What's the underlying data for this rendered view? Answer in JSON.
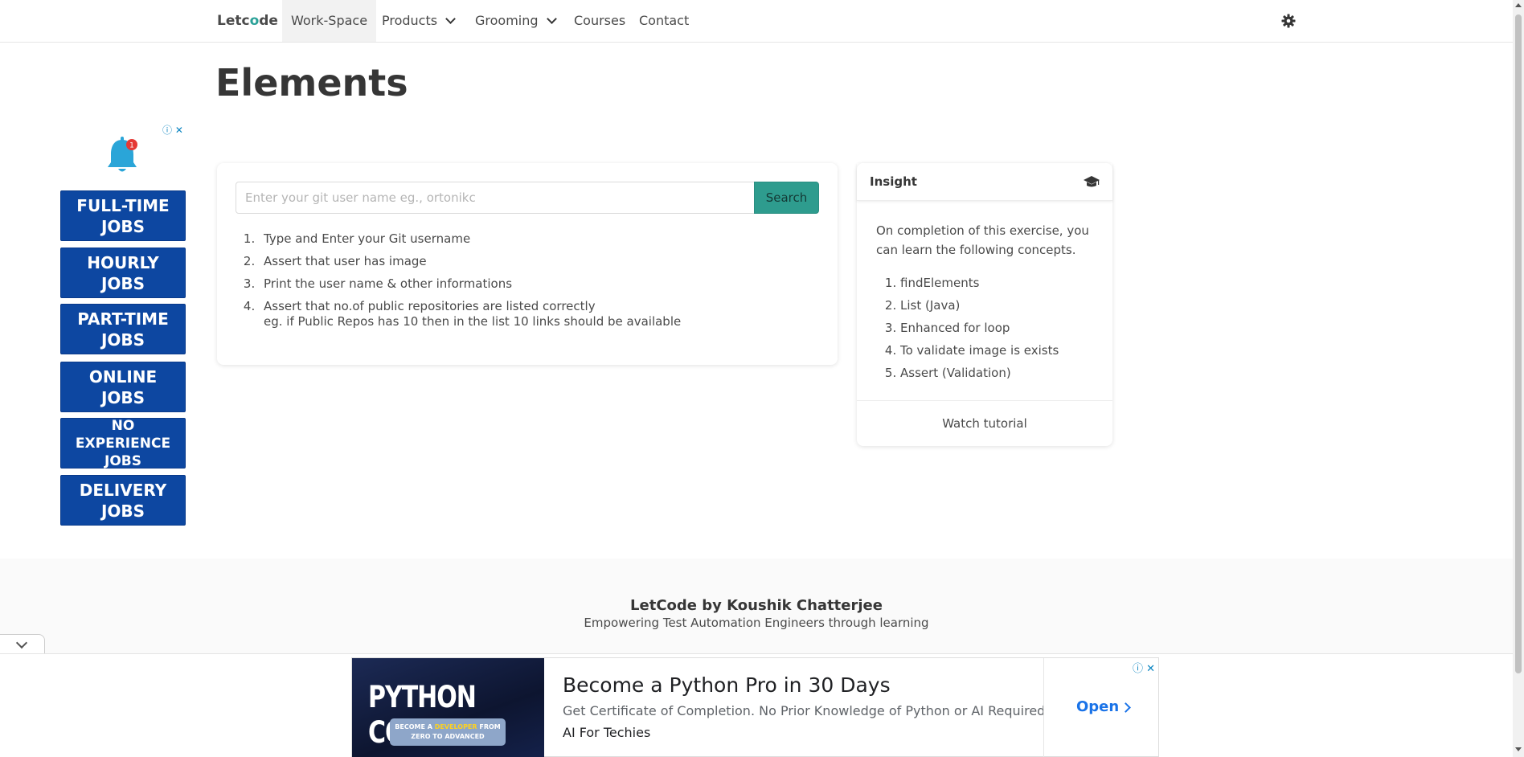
{
  "nav": {
    "brand_prefix": "Letc",
    "brand_o": "o",
    "brand_suffix": "de",
    "items": [
      {
        "label": "Work-Space"
      },
      {
        "label": "Products"
      },
      {
        "label": "Grooming"
      },
      {
        "label": "Courses"
      },
      {
        "label": "Contact"
      }
    ]
  },
  "page": {
    "title": "Elements"
  },
  "left_ad": {
    "bell_badge": "1",
    "jobs": [
      "FULL-TIME JOBS",
      "HOURLY JOBS",
      "PART-TIME JOBS",
      "ONLINE JOBS",
      "NO EXPERIENCE JOBS",
      "DELIVERY JOBS"
    ]
  },
  "search": {
    "placeholder": "Enter your git user name eg., ortonikc",
    "value": "",
    "button_label": "Search"
  },
  "steps": [
    "Type and Enter your Git username",
    "Assert that user has image",
    "Print the user name & other informations",
    "Assert that no.of public repositories are listed correctly"
  ],
  "steps_note": "eg. if Public Repos has 10 then in the list 10 links should be available",
  "insight": {
    "title": "Insight",
    "intro": "On completion of this exercise, you can learn the following concepts.",
    "concepts": [
      "findElements",
      "List (Java)",
      "Enhanced for loop",
      "To validate image is exists",
      "Assert (Validation)"
    ],
    "watch_label": "Watch tutorial"
  },
  "footer": {
    "title": "LetCode by Koushik Chatterjee",
    "subtitle": "Empowering Test Automation Engineers through learning"
  },
  "bottom_ad": {
    "image_word1": "PYTHON",
    "image_word2": "COURSE",
    "badge_line1_pre": "BECOME A ",
    "badge_highlight": "DEVELOPER",
    "badge_line1_post": " FROM",
    "badge_line2": "ZERO TO ADVANCED",
    "headline": "Become a Python Pro in 30 Days",
    "description": "Get Certificate of Completion. No Prior Knowledge of Python or AI Required",
    "source": "AI For Techies",
    "cta": "Open"
  },
  "colors": {
    "accent": "#2e9c8e",
    "job_button": "#0d47a1",
    "link_blue": "#1a73e8"
  }
}
